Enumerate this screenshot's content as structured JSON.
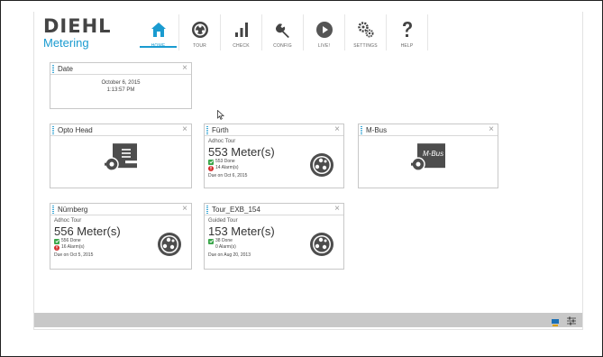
{
  "brand": {
    "top": "DIEHL",
    "bottom": "Metering"
  },
  "nav": [
    {
      "key": "home",
      "label": "HOME",
      "icon": "home-icon",
      "active": true
    },
    {
      "key": "tour",
      "label": "TOUR",
      "icon": "tour-wheel-icon",
      "active": false
    },
    {
      "key": "check",
      "label": "CHECK",
      "icon": "bar-chart-icon",
      "active": false
    },
    {
      "key": "config",
      "label": "CONFIG",
      "icon": "wrench-icon",
      "active": false
    },
    {
      "key": "live",
      "label": "LIVE!",
      "icon": "play-icon",
      "active": false
    },
    {
      "key": "settings",
      "label": "SETTINGS",
      "icon": "gears-icon",
      "active": false
    },
    {
      "key": "help",
      "label": "HELP",
      "icon": "question-icon",
      "active": false
    }
  ],
  "date_card": {
    "title": "Date",
    "date": "October 6, 2015",
    "time": "1:13:57 PM"
  },
  "opto_card": {
    "title": "Opto Head",
    "icon": "opto-head-icon"
  },
  "mbus_card": {
    "title": "M-Bus",
    "icon": "mbus-icon",
    "icon_text": "M-Bus"
  },
  "tours": {
    "furth": {
      "title": "Fürth",
      "type": "Adhoc Tour",
      "meters": "553 Meter(s)",
      "done": "553 Done",
      "alarms": "14 Alarm(s)",
      "due": "Due on Oct 6, 2015",
      "alarm_flag": true
    },
    "nurnberg": {
      "title": "Nürnberg",
      "type": "Adhoc Tour",
      "meters": "556 Meter(s)",
      "done": "556 Done",
      "alarms": "16 Alarm(s)",
      "due": "Due on Oct 5, 2015",
      "alarm_flag": true
    },
    "exb": {
      "title": "Tour_EXB_154",
      "type": "Guided Tour",
      "meters": "153 Meter(s)",
      "done": "38 Done",
      "alarms": "0 Alarm(s)",
      "due": "Due on Aug 20, 2013",
      "alarm_flag": false
    }
  },
  "footer": {
    "icons": [
      "device-icon",
      "sliders-icon"
    ]
  },
  "colors": {
    "accent": "#1a9bd0",
    "done": "#3aa64a",
    "alarm": "#d42b2b",
    "footer": "#c8c8c8"
  }
}
